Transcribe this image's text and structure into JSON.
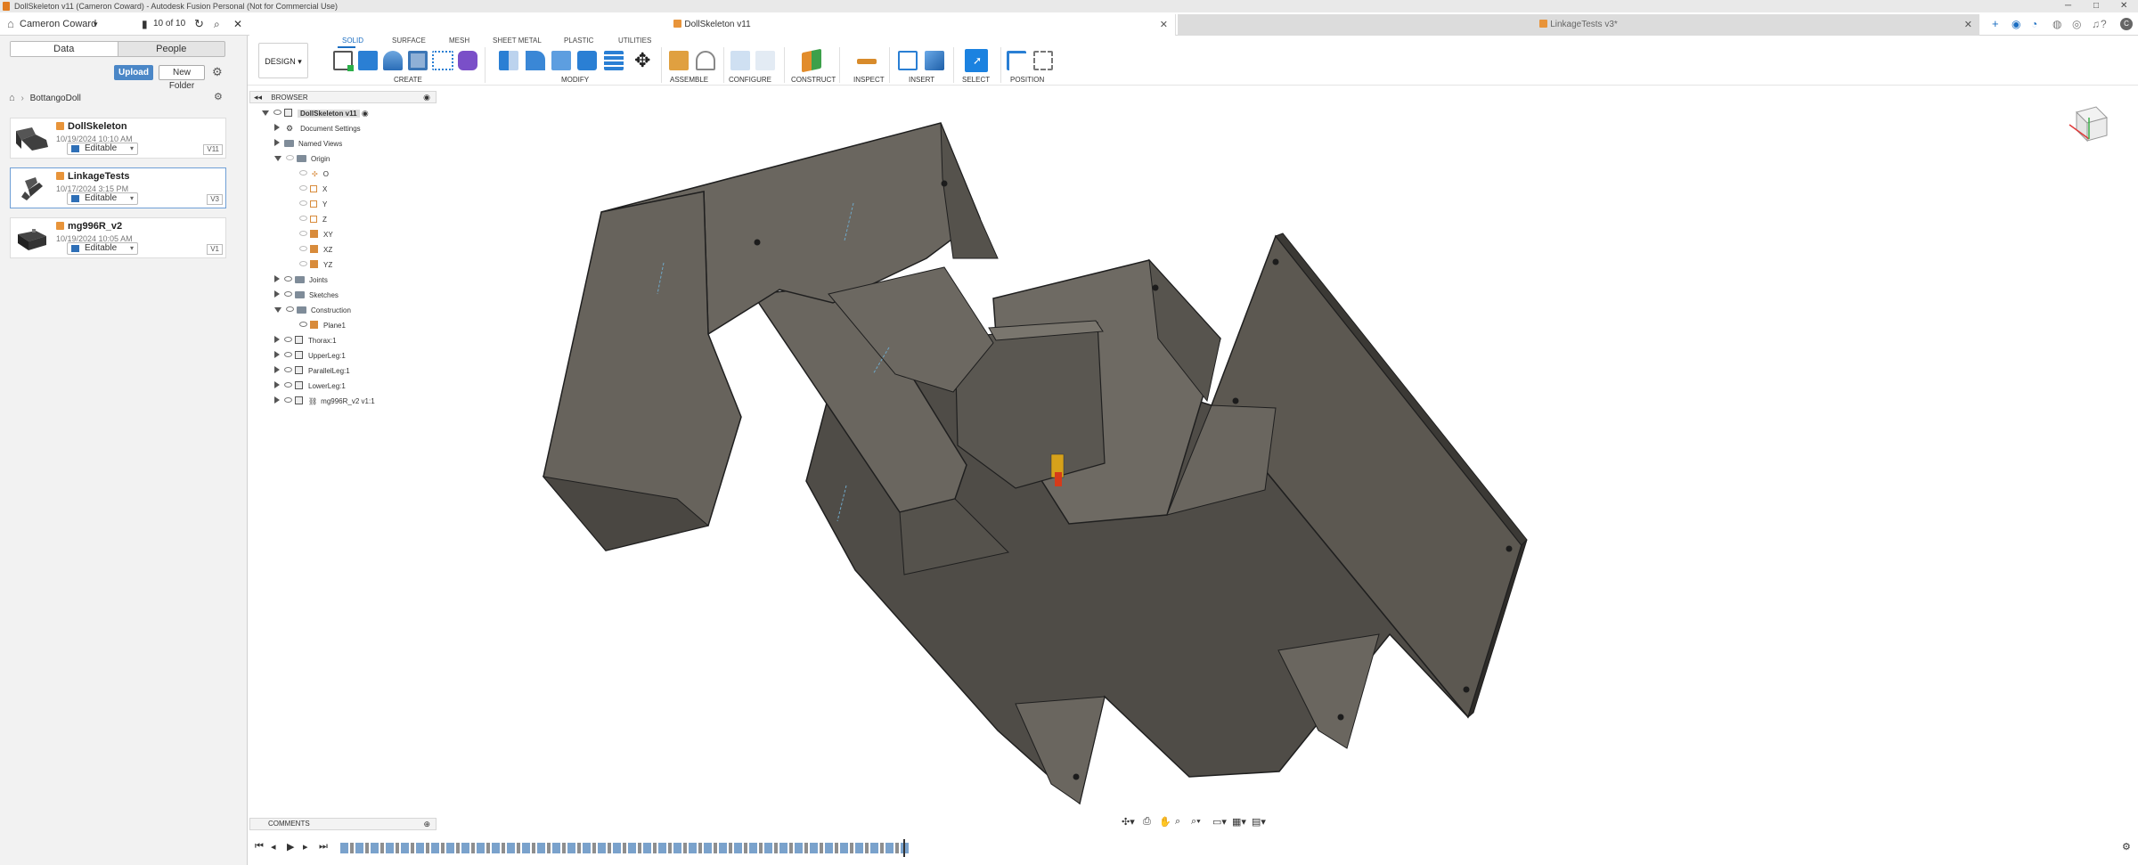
{
  "titlebar": {
    "title": "DollSkeleton v11 (Cameron Coward) - Autodesk Fusion Personal (Not for Commercial Use)"
  },
  "topbar": {
    "user": "Cameron Coward",
    "job_status": "10 of 10"
  },
  "tabs": [
    {
      "label": "DollSkeleton v11",
      "active": true
    },
    {
      "label": "LinkageTests v3*",
      "active": false
    }
  ],
  "datapanel": {
    "tabs": [
      "Data",
      "People"
    ],
    "upload": "Upload",
    "new_folder": "New Folder",
    "breadcrumb": "BottangoDoll",
    "files": [
      {
        "name": "DollSkeleton",
        "date": "10/19/2024 10:10 AM",
        "status": "Editable",
        "version": "V11"
      },
      {
        "name": "LinkageTests",
        "date": "10/17/2024 3:15 PM",
        "status": "Editable",
        "version": "V3"
      },
      {
        "name": "mg996R_v2",
        "date": "10/19/2024 10:05 AM",
        "status": "Editable",
        "version": "V1"
      }
    ]
  },
  "ribbon": {
    "workspace": "DESIGN",
    "tabs": [
      "SOLID",
      "SURFACE",
      "MESH",
      "SHEET METAL",
      "PLASTIC",
      "UTILITIES"
    ],
    "groups": [
      "CREATE",
      "MODIFY",
      "ASSEMBLE",
      "CONFIGURE",
      "CONSTRUCT",
      "INSPECT",
      "INSERT",
      "SELECT",
      "POSITION"
    ]
  },
  "browser": {
    "title": "BROWSER",
    "root": "DollSkeleton v11",
    "items": [
      "Document Settings",
      "Named Views",
      "Origin",
      "O",
      "X",
      "Y",
      "Z",
      "XY",
      "XZ",
      "YZ",
      "Joints",
      "Sketches",
      "Construction",
      "Plane1",
      "Thorax:1",
      "UpperLeg:1",
      "ParallelLeg:1",
      "LowerLeg:1",
      "mg996R_v2 v1:1"
    ]
  },
  "comments": {
    "title": "COMMENTS"
  },
  "colors": {
    "accent": "#1b6ec2",
    "upload": "#4b87c7",
    "model_face": "#6e6a63",
    "model_dark": "#4f4c47"
  }
}
